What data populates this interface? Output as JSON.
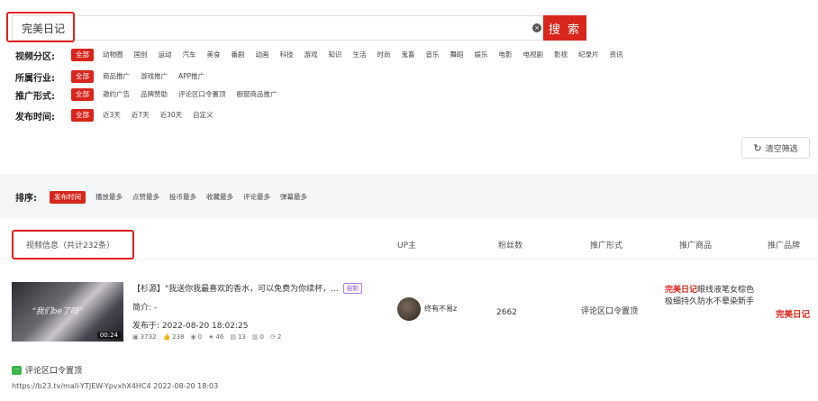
{
  "search": {
    "value": "完美日记",
    "button": "搜 索",
    "clear_glyph": "×"
  },
  "filters": [
    {
      "label": "视频分区:",
      "options": [
        "全部",
        "动物圈",
        "国创",
        "运动",
        "汽车",
        "美食",
        "番剧",
        "动画",
        "科技",
        "游戏",
        "知识",
        "生活",
        "时尚",
        "鬼畜",
        "音乐",
        "舞蹈",
        "娱乐",
        "电影",
        "电视剧",
        "影视",
        "纪录片",
        "资讯"
      ]
    },
    {
      "label": "所属行业:",
      "options": [
        "全部",
        "商品推广",
        "游戏推广",
        "APP推广"
      ]
    },
    {
      "label": "推广形式:",
      "options": [
        "全部",
        "邀约广告",
        "品牌赞助",
        "评论区口令置顶",
        "橱窗商品推广"
      ]
    },
    {
      "label": "发布时间:",
      "options": [
        "全部",
        "近3天",
        "近7天",
        "近30天",
        "自定义"
      ]
    }
  ],
  "clear_filters": {
    "icon_glyph": "↻",
    "label": "清空筛选"
  },
  "sort": {
    "label": "排序:",
    "options": [
      "发布时间",
      "播放最多",
      "点赞最多",
      "投币最多",
      "收藏最多",
      "评论最多",
      "弹幕最多"
    ],
    "active": 0
  },
  "table": {
    "headers": [
      "视频信息（共计232条）",
      "UP主",
      "粉丝数",
      "推广形式",
      "推广商品",
      "推广品牌"
    ]
  },
  "video": {
    "thumb_caption": "“我们be了吗”",
    "duration": "00:24",
    "title": "【杉源】\"我送你我最喜欢的香水，可以免费为你续杯，...",
    "tag": "自制",
    "intro": "简介: -",
    "published": "发布于: 2022-08-20 18:02:25",
    "stats": [
      {
        "icon": "▣",
        "value": "3732"
      },
      {
        "icon": "👍",
        "value": "238"
      },
      {
        "icon": "◉",
        "value": "0"
      },
      {
        "icon": "★",
        "value": "46"
      },
      {
        "icon": "▤",
        "value": "13"
      },
      {
        "icon": "▥",
        "value": "0"
      },
      {
        "icon": "⟳",
        "value": "2"
      }
    ],
    "up_name": "终有不易z",
    "fans": "2662",
    "promo_type": "评论区口令置顶",
    "product_keyword": "完美日记",
    "product_rest": "眼线液笔女棕色极细持久防水不晕染新手",
    "brand": "完美日记"
  },
  "comment": {
    "icon_glyph": "···",
    "label": "评论区口令置顶",
    "link": "https://b23.tv/mall-YTJEW-YpvxhX4HC4 2022-08-20 18:03"
  }
}
